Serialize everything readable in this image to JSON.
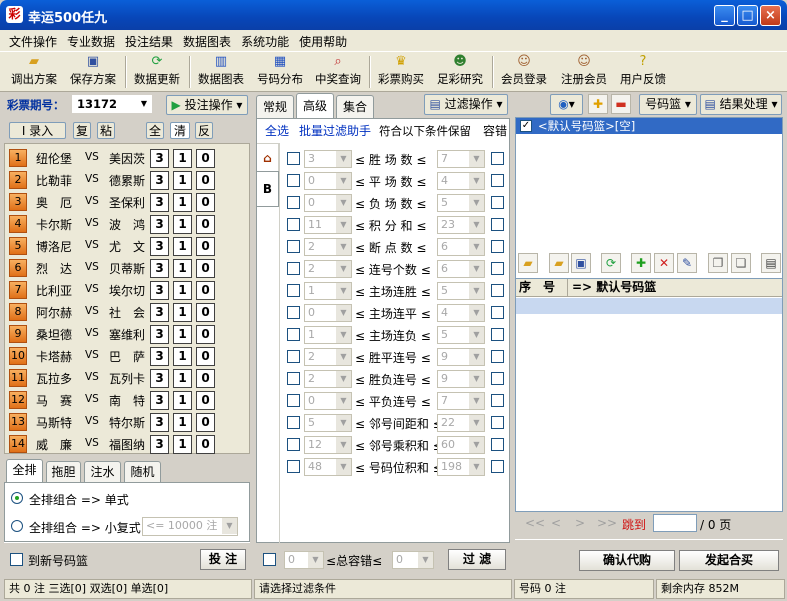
{
  "window": {
    "title": "幸运500任九",
    "app_icon": "lottery-app-icon",
    "controls": [
      "_",
      "□",
      "×"
    ]
  },
  "menu": [
    "文件操作",
    "专业数据",
    "投注结果",
    "数据图表",
    "系统功能",
    "使用帮助"
  ],
  "toolbar": [
    {
      "label": "调出方案",
      "icon": "folder-open-icon"
    },
    {
      "label": "保存方案",
      "icon": "save-icon"
    },
    {
      "label": "数据更新",
      "icon": "refresh-icon"
    },
    {
      "label": "数据图表",
      "icon": "chart-icon"
    },
    {
      "label": "号码分布",
      "icon": "grid-icon"
    },
    {
      "label": "中奖查询",
      "icon": "search-icon"
    },
    {
      "label": "彩票购买",
      "icon": "ticket-icon"
    },
    {
      "label": "足彩研究",
      "icon": "users-icon"
    },
    {
      "label": "会员登录",
      "icon": "user-login-icon"
    },
    {
      "label": "注册会员",
      "icon": "user-add-icon"
    },
    {
      "label": "用户反馈",
      "icon": "help-icon"
    }
  ],
  "issue": {
    "label": "彩票期号：",
    "value": "13172",
    "bet_op": "投注操作"
  },
  "left_buttons": {
    "entry": "I 录入",
    "copy": "复",
    "paste": "粘",
    "all": "全",
    "clear": "清",
    "invert": "反"
  },
  "matches": [
    {
      "no": "1",
      "home": "纽伦堡",
      "vs": "VS",
      "away": "美因茨",
      "odds": [
        "3",
        "1",
        "0"
      ]
    },
    {
      "no": "2",
      "home": "比勒菲",
      "vs": "VS",
      "away": "德累斯",
      "odds": [
        "3",
        "1",
        "0"
      ]
    },
    {
      "no": "3",
      "home": "奥　厄",
      "vs": "VS",
      "away": "圣保利",
      "odds": [
        "3",
        "1",
        "0"
      ]
    },
    {
      "no": "4",
      "home": "卡尔斯",
      "vs": "VS",
      "away": "波　鸿",
      "odds": [
        "3",
        "1",
        "0"
      ]
    },
    {
      "no": "5",
      "home": "博洛尼",
      "vs": "VS",
      "away": "尤　文",
      "odds": [
        "3",
        "1",
        "0"
      ]
    },
    {
      "no": "6",
      "home": "烈　达",
      "vs": "VS",
      "away": "贝蒂斯",
      "odds": [
        "3",
        "1",
        "0"
      ]
    },
    {
      "no": "7",
      "home": "比利亚",
      "vs": "VS",
      "away": "埃尔切",
      "odds": [
        "3",
        "1",
        "0"
      ]
    },
    {
      "no": "8",
      "home": "阿尔赫",
      "vs": "VS",
      "away": "社　会",
      "odds": [
        "3",
        "1",
        "0"
      ]
    },
    {
      "no": "9",
      "home": "桑坦德",
      "vs": "VS",
      "away": "塞维利",
      "odds": [
        "3",
        "1",
        "0"
      ]
    },
    {
      "no": "10",
      "home": "卡塔赫",
      "vs": "VS",
      "away": "巴　萨",
      "odds": [
        "3",
        "1",
        "0"
      ]
    },
    {
      "no": "11",
      "home": "瓦拉多",
      "vs": "VS",
      "away": "瓦列卡",
      "odds": [
        "3",
        "1",
        "0"
      ]
    },
    {
      "no": "12",
      "home": "马　赛",
      "vs": "VS",
      "away": "南　特",
      "odds": [
        "3",
        "1",
        "0"
      ]
    },
    {
      "no": "13",
      "home": "马斯特",
      "vs": "VS",
      "away": "特尔斯",
      "odds": [
        "3",
        "1",
        "0"
      ]
    },
    {
      "no": "14",
      "home": "威　廉",
      "vs": "VS",
      "away": "福图纳",
      "odds": [
        "3",
        "1",
        "0"
      ]
    }
  ],
  "bottom_tabs": [
    "全排",
    "拖胆",
    "注水",
    "随机"
  ],
  "combo": {
    "opt1": "全排组合 => 单式",
    "opt2": "全排组合 => 小复式",
    "opt2_select": "<= 10000 注",
    "to_new": "到新号码篮",
    "bet_btn": "投 注"
  },
  "mid_tabs": [
    "常规",
    "高级",
    "集合"
  ],
  "filter_op": "过滤操作",
  "filter_header": {
    "select_all": "全选",
    "batch": "批量过滤助手",
    "keep": "符合以下条件保留",
    "tolerance": "容错"
  },
  "side_tabs": [
    "A",
    "B"
  ],
  "filters": [
    {
      "min": "3",
      "label": "胜 场 数",
      "max": "7"
    },
    {
      "min": "0",
      "label": "平 场 数",
      "max": "4"
    },
    {
      "min": "0",
      "label": "负 场 数",
      "max": "5"
    },
    {
      "min": "11",
      "label": "积 分 和",
      "max": "23"
    },
    {
      "min": "2",
      "label": "断 点 数",
      "max": "6"
    },
    {
      "min": "2",
      "label": "连号个数",
      "max": "6"
    },
    {
      "min": "1",
      "label": "主场连胜",
      "max": "5"
    },
    {
      "min": "0",
      "label": "主场连平",
      "max": "4"
    },
    {
      "min": "1",
      "label": "主场连负",
      "max": "5"
    },
    {
      "min": "2",
      "label": "胜平连号",
      "max": "9"
    },
    {
      "min": "2",
      "label": "胜负连号",
      "max": "9"
    },
    {
      "min": "0",
      "label": "平负连号",
      "max": "7"
    },
    {
      "min": "5",
      "label": "邻号间距和",
      "max": "22"
    },
    {
      "min": "12",
      "label": "邻号乘积和",
      "max": "60"
    },
    {
      "min": "48",
      "label": "号码位积和",
      "max": "198"
    }
  ],
  "filter_sign": "≤",
  "total_tol": {
    "min": "0",
    "label": "总容错",
    "max": "0",
    "sign": "≤",
    "btn": "过 滤"
  },
  "right": {
    "basket_sel": "号码篮",
    "result_op": "结果处理",
    "basket_item": "<默认号码篮>[空]",
    "col_no": "序　号",
    "col_name": "=> 默认号码篮",
    "pager": {
      "first": "<<",
      "prev": "<",
      "next": ">",
      "last": ">>",
      "jump": "跳到",
      "page": "/ 0 页"
    },
    "confirm": "确认代购",
    "publish": "发起合买"
  },
  "statusbar": [
    "共 0 注 三选[0] 双选[0] 单选[0]",
    "请选择过滤条件",
    "号码 0 注",
    "剩余内存 852M"
  ],
  "colors": {
    "title_bar": "#0a5fd8",
    "accent_orange": "#f08020",
    "selection": "#316ac5"
  }
}
